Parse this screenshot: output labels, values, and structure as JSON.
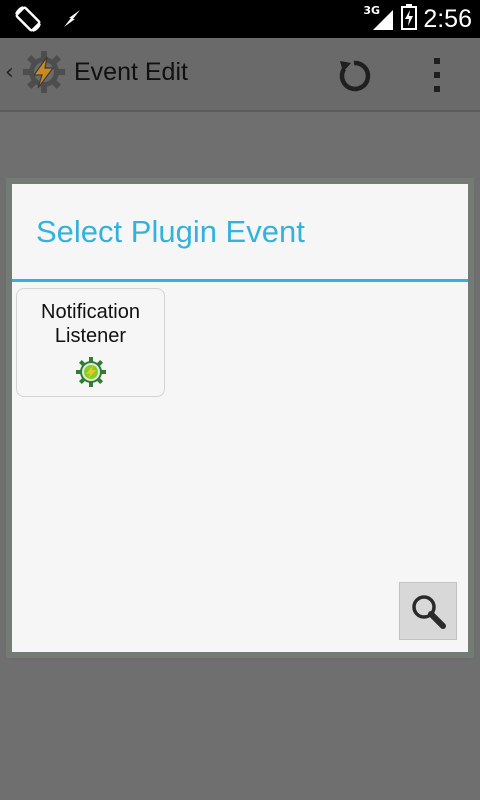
{
  "status_bar": {
    "time": "2:56",
    "network_type": "3G",
    "icons": [
      "screen-rotation-icon",
      "lightning-icon",
      "signal-icon",
      "battery-charging-icon"
    ]
  },
  "action_bar": {
    "title": "Event Edit",
    "up_glyph": "‹",
    "icons": [
      "tasker-app-icon",
      "refresh-icon",
      "overflow-menu-icon"
    ]
  },
  "dialog": {
    "title": "Select Plugin Event",
    "accent_color": "#35b2dc",
    "plugins": [
      {
        "label": "Notification\nListener",
        "icon": "plugin-gear-icon"
      }
    ],
    "search_icon": "search-icon"
  }
}
